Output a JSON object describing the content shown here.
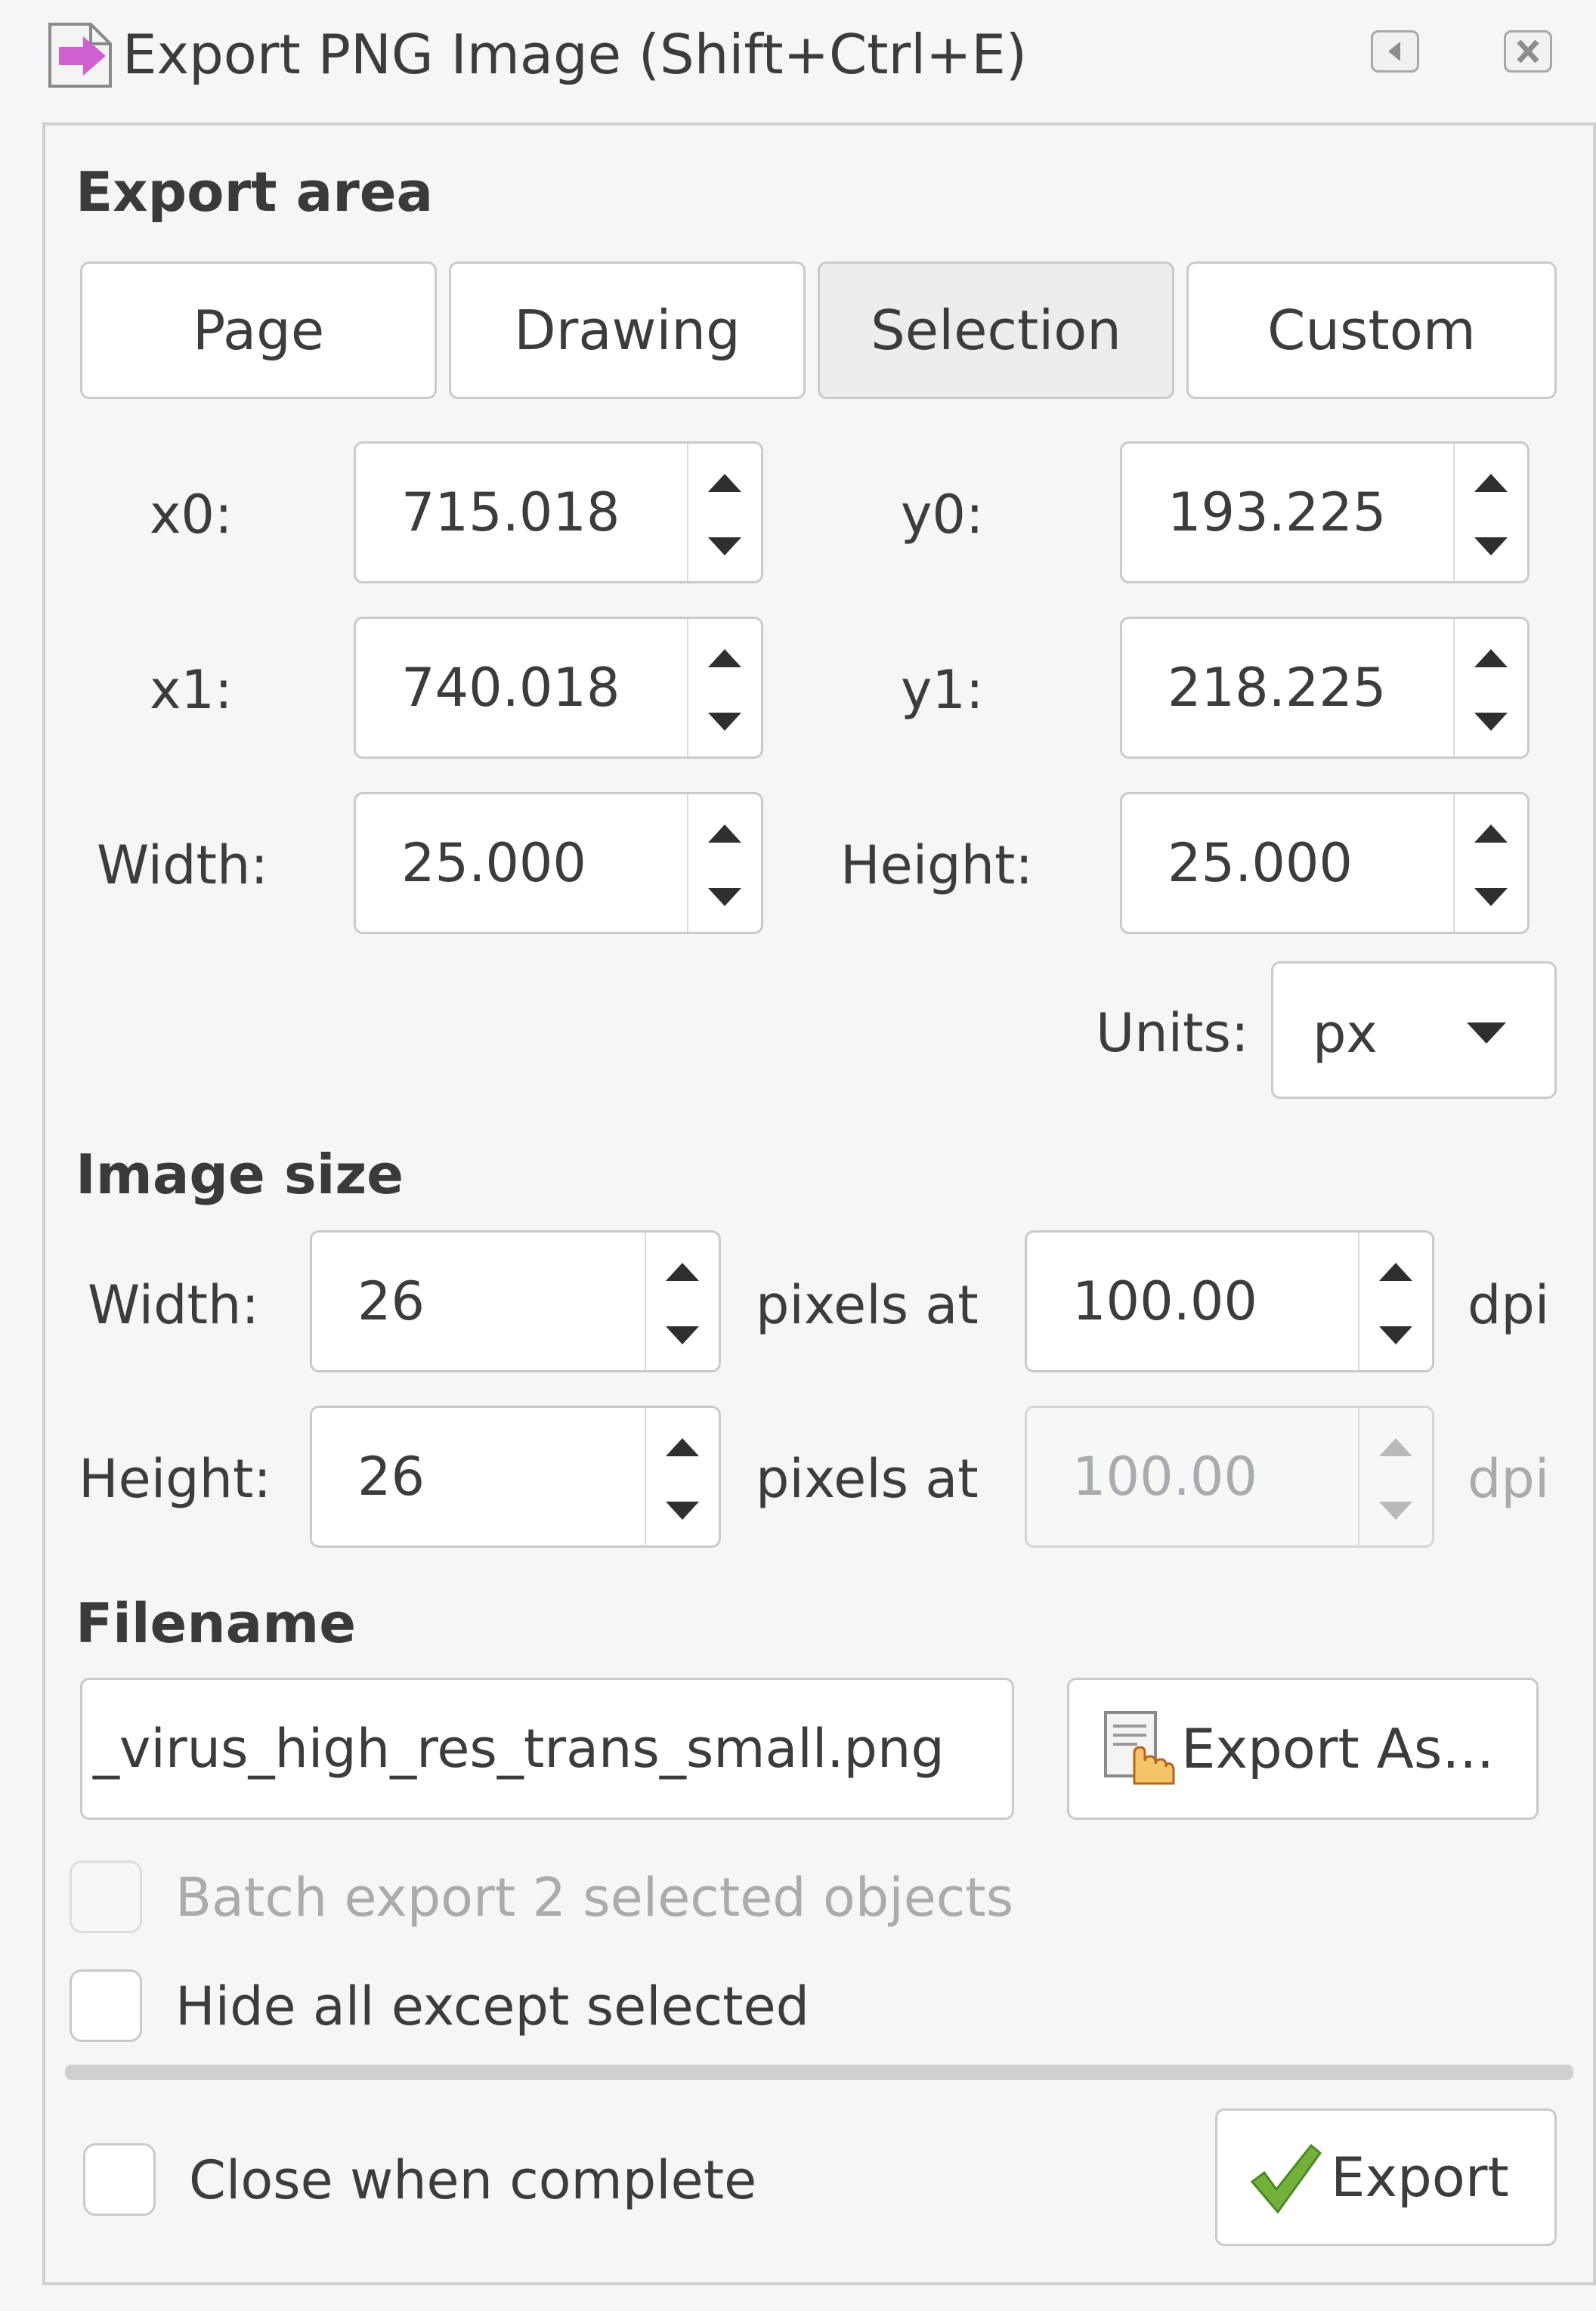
{
  "window": {
    "title": "Export PNG Image (Shift+Ctrl+E)",
    "icon": "export-png-icon",
    "buttons": [
      "restore-icon",
      "close-icon"
    ]
  },
  "export_area": {
    "label": "Export area",
    "tabs": [
      "Page",
      "Drawing",
      "Selection",
      "Custom"
    ],
    "active_tab": "Selection",
    "x0_label": "x0:",
    "x0": "715.018",
    "y0_label": "y0:",
    "y0": "193.225",
    "x1_label": "x1:",
    "x1": "740.018",
    "y1_label": "y1:",
    "y1": "218.225",
    "width_label": "Width:",
    "width": "25.000",
    "height_label": "Height:",
    "height": "25.000",
    "units_label": "Units:",
    "units": "px"
  },
  "image_size": {
    "label": "Image size",
    "width_label": "Width:",
    "width": "26",
    "height_label": "Height:",
    "height": "26",
    "pixels_at": "pixels at",
    "dpi_x": "100.00",
    "dpi_y": "100.00",
    "dpi_unit": "dpi"
  },
  "filename": {
    "label": "Filename",
    "value": "_virus_high_res_trans_small.png",
    "export_as": "Export As..."
  },
  "options": {
    "batch_export": "Batch export 2 selected objects",
    "hide_all": "Hide all except selected",
    "close_when_complete": "Close when complete"
  },
  "export_button": "Export",
  "colors": {
    "accent_check": "#73b13b",
    "icon_magenta": "#d25fd2"
  }
}
